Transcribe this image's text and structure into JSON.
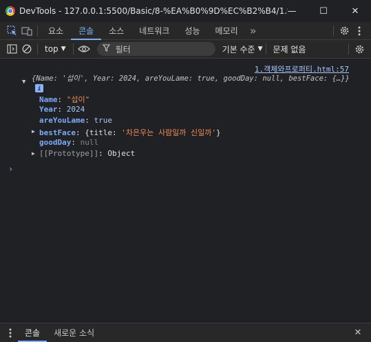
{
  "window": {
    "title": "DevTools - 127.0.0.1:5500/Basic/8-%EA%B0%9D%EC%B2%B4/1.%E...",
    "minimize": "—",
    "maximize": "☐",
    "close": "✕"
  },
  "tabs": [
    {
      "label": "요소"
    },
    {
      "label": "콘솔",
      "active": true
    },
    {
      "label": "소스"
    },
    {
      "label": "네트워크"
    },
    {
      "label": "성능"
    },
    {
      "label": "메모리"
    }
  ],
  "more_tabs": "»",
  "console_toolbar": {
    "context": "top",
    "filter_placeholder": "필터",
    "levels": "기본 수준",
    "issues": "문제 없음"
  },
  "console": {
    "source_link": "1.객체와프로퍼티.html:57",
    "preview": "{Name: '섭이', Year: 2024, areYouLame: true, goodDay: null, bestFace: {…}}",
    "properties": [
      {
        "key": "Name",
        "sep": ": ",
        "value": "\"섭이\"",
        "type": "string"
      },
      {
        "key": "Year",
        "sep": ": ",
        "value": "2024",
        "type": "number"
      },
      {
        "key": "areYouLame",
        "sep": ": ",
        "value": "true",
        "type": "boolean"
      },
      {
        "key": "bestFace",
        "sep": ": ",
        "value_open": "{title: ",
        "value_str": "'차은우는 사람일까 신일까'",
        "value_close": "}",
        "type": "object"
      },
      {
        "key": "goodDay",
        "sep": ": ",
        "value": "null",
        "type": "null"
      },
      {
        "key": "[[Prototype]]",
        "sep": ": ",
        "value": "Object",
        "type": "proto"
      }
    ],
    "prompt": "›"
  },
  "drawer": {
    "tabs": [
      {
        "label": "콘솔",
        "active": true
      },
      {
        "label": "새로운 소식"
      }
    ],
    "close": "✕"
  },
  "colors": {
    "accent": "#7cacf8",
    "background": "#202124",
    "toolbar": "#282828"
  }
}
